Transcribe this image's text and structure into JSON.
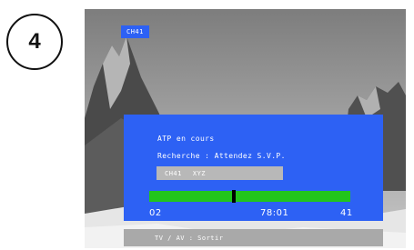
{
  "step_number": "4",
  "screen": {
    "channel_tag": "CH41",
    "dialog": {
      "title": "ATP en cours",
      "status": "Recherche : Attendez S.V.P.",
      "channel_field": {
        "channel": "CH41",
        "name": "XYZ"
      },
      "progress": {
        "min_label": "02",
        "center_label": "78:01",
        "max_label": "41",
        "marker_fraction": 0.42
      }
    },
    "footer_hint": "TV / AV : Sortir"
  },
  "colors": {
    "osd_blue": "#2d61f4",
    "progress_green": "#22c51b",
    "field_gray": "#b8b8b8"
  }
}
